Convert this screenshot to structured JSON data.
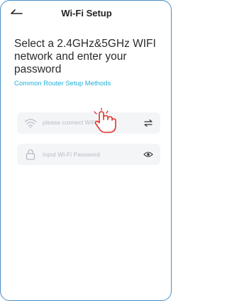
{
  "header": {
    "title": "Wi-Fi Setup"
  },
  "main": {
    "heading": "Select a 2.4GHz&5GHz WIFI network and enter your password",
    "link": "Common Router Setup Methods",
    "wifi_field": {
      "placeholder": "please connect WiFi"
    },
    "password_field": {
      "placeholder": "Input Wi-Fi Password"
    }
  },
  "colors": {
    "accent": "#1fb0d8",
    "border": "#4a8fc8",
    "hand": "#e0322b"
  },
  "icons": [
    "back-arrow-icon",
    "wifi-icon",
    "switch-arrows-icon",
    "lock-icon",
    "eye-icon",
    "tap-hand-icon"
  ]
}
